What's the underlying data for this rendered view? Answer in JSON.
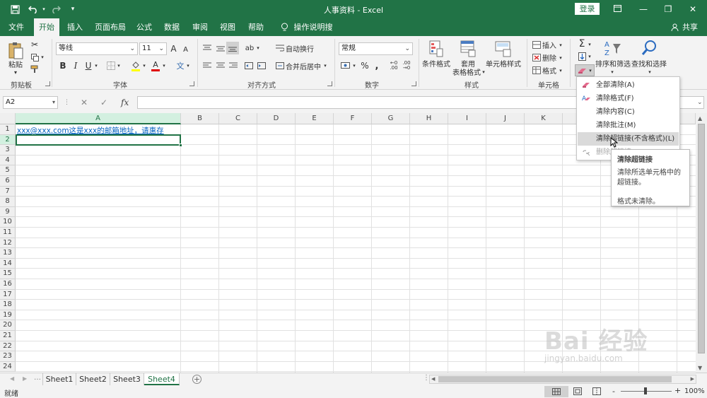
{
  "titlebar": {
    "title": "人事资料 - Excel",
    "login": "登录",
    "icons": {
      "save": "save-icon",
      "undo": "undo-icon",
      "redo": "redo-icon",
      "customize": "customize-qat-icon",
      "ribbon_opts": "ribbon-display-icon",
      "minimize": "minimize-icon",
      "restore": "restore-icon",
      "close": "close-icon"
    }
  },
  "tabs": [
    {
      "label": "文件"
    },
    {
      "label": "开始"
    },
    {
      "label": "插入"
    },
    {
      "label": "页面布局"
    },
    {
      "label": "公式"
    },
    {
      "label": "数据"
    },
    {
      "label": "审阅"
    },
    {
      "label": "视图"
    },
    {
      "label": "帮助"
    },
    {
      "label": "操作说明搜索"
    }
  ],
  "share": "共享",
  "ribbon": {
    "clipboard": {
      "paste": "粘贴",
      "label": "剪贴板"
    },
    "font": {
      "name": "等线",
      "size": "11",
      "label": "字体",
      "bold": "B",
      "italic": "I",
      "underline": "U",
      "grow": "A",
      "shrink": "A",
      "font_color": "A",
      "phonetic": "文"
    },
    "align": {
      "wrap": "自动换行",
      "merge": "合并后居中",
      "label": "对齐方式"
    },
    "number": {
      "format": "常规",
      "label": "数字",
      "percent": "%",
      "comma": ","
    },
    "styles": {
      "cond": "条件格式",
      "table1": "套用",
      "table2": "表格格式",
      "cell": "单元格样式",
      "label": "样式"
    },
    "cells": {
      "insert": "插入",
      "delete": "删除",
      "format": "格式",
      "label": "单元格"
    },
    "editing": {
      "sort": "排序和筛选",
      "find": "查找和选择",
      "sigma": "Σ"
    }
  },
  "formula": {
    "namebox": "A2",
    "cancel": "✕",
    "enter": "✓",
    "fx": "fx"
  },
  "columns": [
    "A",
    "B",
    "C",
    "D",
    "E",
    "F",
    "G",
    "H",
    "I",
    "J",
    "K"
  ],
  "rows": [
    "1",
    "2",
    "3",
    "4",
    "5",
    "6",
    "7",
    "8",
    "9",
    "10",
    "11",
    "12",
    "13",
    "14",
    "15",
    "16",
    "17",
    "18",
    "19",
    "20",
    "21",
    "22",
    "23",
    "24"
  ],
  "cell_a1": "xxx@xxx.com这是xxx的邮箱地址，请惠存",
  "clear_menu": [
    {
      "label": "全部清除(A)",
      "icon": "eraser-icon",
      "state": "normal"
    },
    {
      "label": "清除格式(F)",
      "icon": "clear-format-icon",
      "state": "normal"
    },
    {
      "label": "清除内容(C)",
      "icon": "",
      "state": "normal"
    },
    {
      "label": "清除批注(M)",
      "icon": "",
      "state": "normal"
    },
    {
      "label": "清除超链接(不含格式)(L)",
      "icon": "",
      "state": "highlighted"
    },
    {
      "label": "删除超链接",
      "icon": "remove-link-icon",
      "state": "disabled"
    }
  ],
  "tooltip": {
    "title": "清除超链接",
    "desc": "清除所选单元格中的超链接。",
    "note": "格式未清除。"
  },
  "sheets": [
    {
      "label": "Sheet1"
    },
    {
      "label": "Sheet2"
    },
    {
      "label": "Sheet3"
    },
    {
      "label": "Sheet4"
    }
  ],
  "status": {
    "ready": "就绪",
    "zoom": "100%",
    "minus": "-",
    "plus": "+"
  },
  "watermark": {
    "brand": "Bai 经验",
    "url": "jingyan.baidu.com"
  },
  "colors": {
    "accent": "#217346",
    "link": "#0563c1"
  }
}
